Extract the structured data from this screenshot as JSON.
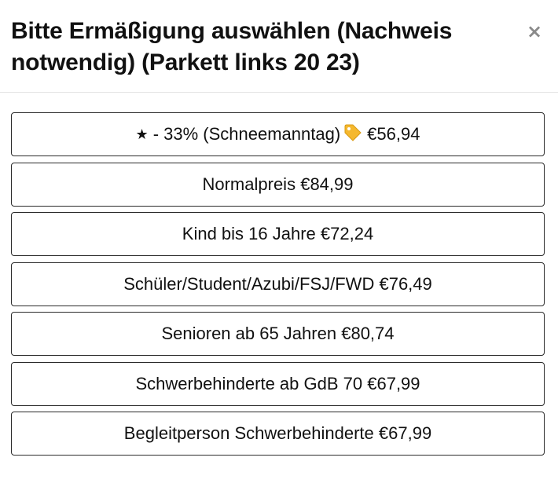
{
  "dialog": {
    "title": "Bitte Ermäßigung auswählen (Nachweis notwendig) (Parkett links 20 23)",
    "close_label": "×"
  },
  "options": [
    {
      "label": "- 33% (Schneemanntag)",
      "price": "€56,94",
      "icon_before": "star-icon",
      "icon_after": "tag-icon"
    },
    {
      "label": "Normalpreis",
      "price": "€84,99"
    },
    {
      "label": "Kind bis 16 Jahre",
      "price": "€72,24"
    },
    {
      "label": "Schüler/Student/Azubi/FSJ/FWD",
      "price": "€76,49"
    },
    {
      "label": "Senioren ab 65 Jahren",
      "price": "€80,74"
    },
    {
      "label": "Schwerbehinderte ab GdB 70",
      "price": "€67,99"
    },
    {
      "label": "Begleitperson Schwerbehinderte",
      "price": "€67,99"
    }
  ],
  "colors": {
    "text": "#111111",
    "border": "#2a2a2a",
    "divider": "#e3e3e3",
    "close_icon": "#8a8a8a",
    "tag_icon": "#f5b82e"
  }
}
